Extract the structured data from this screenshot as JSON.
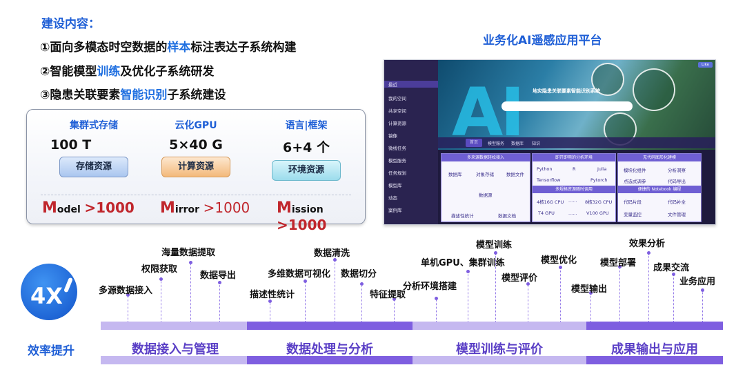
{
  "section_title": "建设内容：",
  "bullets": [
    {
      "prefix": "①面向多模态时空数据的",
      "highlight": "样本",
      "suffix": "标注表达子系统构建"
    },
    {
      "prefix": "②智能模型",
      "highlight": "训练",
      "suffix": "及优化子系统研发"
    },
    {
      "prefix": "③隐患关联要素",
      "highlight": "智能识别",
      "suffix": "子系统建设"
    }
  ],
  "resources": [
    {
      "label": "集群式存储",
      "value": "100 T",
      "button": "存储资源"
    },
    {
      "label": "云化GPU",
      "value": "5×40 G",
      "button": "计算资源"
    },
    {
      "label": "语言|框架",
      "value": "6+4 个",
      "button": "环境资源"
    }
  ],
  "m_metrics": [
    {
      "initial": "M",
      "word": "odel",
      "num": ">1000"
    },
    {
      "initial": "M",
      "word": "irror",
      "num": ">1000"
    },
    {
      "initial": "M",
      "word": "ission",
      "num": ">1000"
    }
  ],
  "platform": {
    "title": "业务化AI遥感应用平台",
    "hero_text": "AI",
    "hero_title": "地灾隐患关联要素智能识别系统",
    "badge": "Like",
    "sidebar": [
      "最近",
      "我的空间",
      "共享空间",
      "计算资源",
      "镜像",
      "微线任务",
      "模型服务",
      "任务规划",
      "模型库",
      "动态",
      "案例库"
    ],
    "tabs": [
      "首页",
      "模型服务",
      "数据库",
      "知识"
    ],
    "card1": {
      "title": "多来源数据轻松接入",
      "cells": [
        "数据库",
        "对象存储",
        "数据文件",
        "数据源",
        "描述性统计",
        "数据文档"
      ]
    },
    "card2": {
      "title": "即开即用的分析环境",
      "cells": [
        "Python",
        "R",
        "Julia",
        "Tensorflow",
        "Pytorch"
      ],
      "title2": "多规格资源随时调用",
      "cells2": [
        "4核16G CPU",
        "8核32G CPU",
        "T4 GPU",
        "V100 GPU"
      ],
      "dots": "......"
    },
    "card3": {
      "title": "无代码图形化建模",
      "cells": [
        "模块化组件",
        "分析洞察",
        "点选式调参",
        "代码导出"
      ],
      "title2": "便捷的 Notebook 编程",
      "cells2": [
        "代码片段",
        "代码补全",
        "变量监控",
        "文件管理"
      ]
    }
  },
  "circle_text": "4X",
  "efficiency_label": "效率提升",
  "phases": [
    "数据接入与管理",
    "数据处理与分析",
    "模型训练与评价",
    "成果输出与应用"
  ],
  "milestones": [
    "多源数据接入",
    "权限获取",
    "海量数据提取",
    "数据导出",
    "描述性统计",
    "多维数据可视化",
    "数据清洗",
    "数据切分",
    "特征提取",
    "分析环境搭建",
    "单机GPU、集群训练",
    "模型训练",
    "模型评价",
    "模型优化",
    "模型输出",
    "模型部署",
    "效果分析",
    "成果交流",
    "业务应用"
  ]
}
